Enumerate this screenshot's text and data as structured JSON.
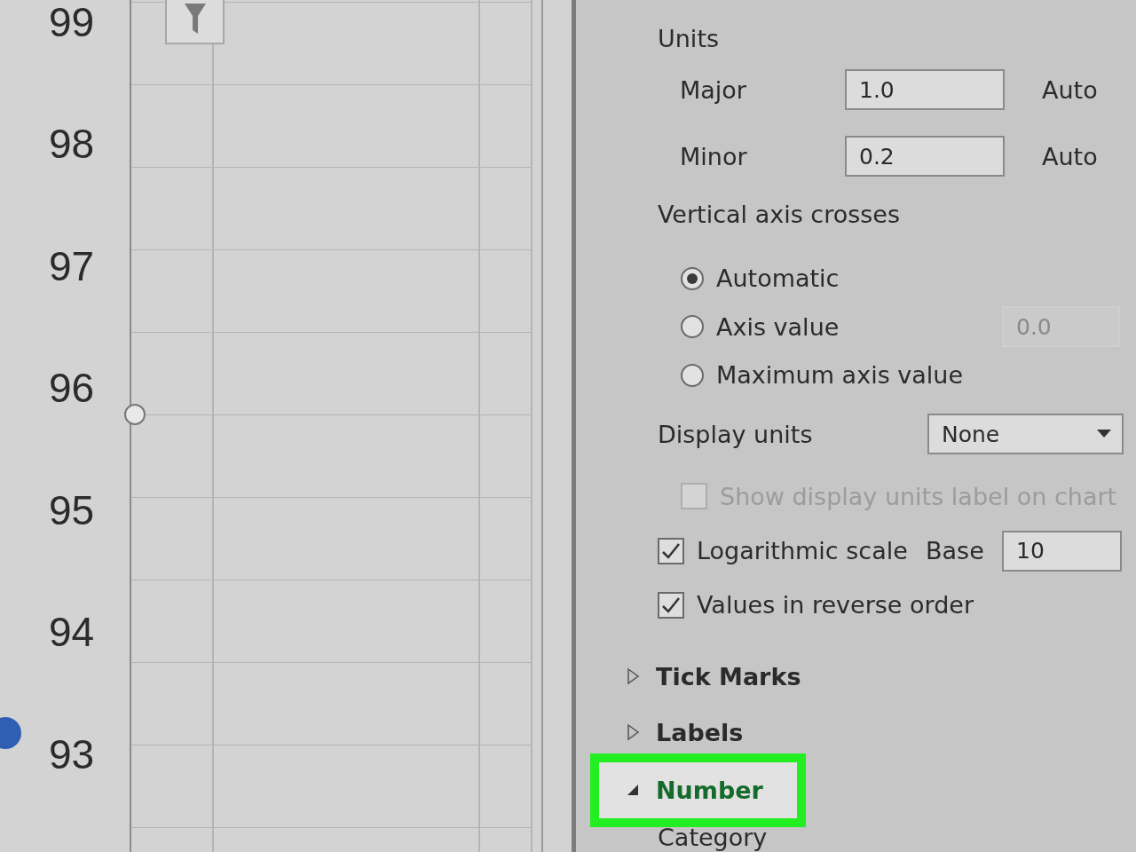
{
  "chart": {
    "y_labels": [
      "99",
      "98",
      "97",
      "96",
      "95",
      "94",
      "93"
    ]
  },
  "panel": {
    "units_heading": "Units",
    "unit_rows": [
      {
        "label": "Major",
        "value": "1.0",
        "auto": "Auto"
      },
      {
        "label": "Minor",
        "value": "0.2",
        "auto": "Auto"
      }
    ],
    "crosses_heading": "Vertical axis crosses",
    "radios": [
      {
        "label": "Automatic",
        "selected": true
      },
      {
        "label": "Axis value",
        "selected": false,
        "value": "0.0"
      },
      {
        "label": "Maximum axis value",
        "selected": false
      }
    ],
    "display_units": {
      "label": "Display units",
      "value": "None"
    },
    "checks": [
      {
        "kind": "plain",
        "label": "Show display units label on chart",
        "checked": false,
        "disabled": true
      },
      {
        "kind": "base",
        "label": "Logarithmic scale",
        "checked": true,
        "disabled": false,
        "base_label": "Base",
        "base_value": "10"
      },
      {
        "kind": "plain",
        "label": "Values in reverse order",
        "checked": true,
        "disabled": false
      }
    ],
    "sections": [
      {
        "label": "Tick Marks",
        "expanded": false,
        "highlighted": false
      },
      {
        "label": "Labels",
        "expanded": false,
        "highlighted": false
      },
      {
        "label": "Number",
        "expanded": true,
        "highlighted": true
      }
    ],
    "category_label": "Category"
  }
}
